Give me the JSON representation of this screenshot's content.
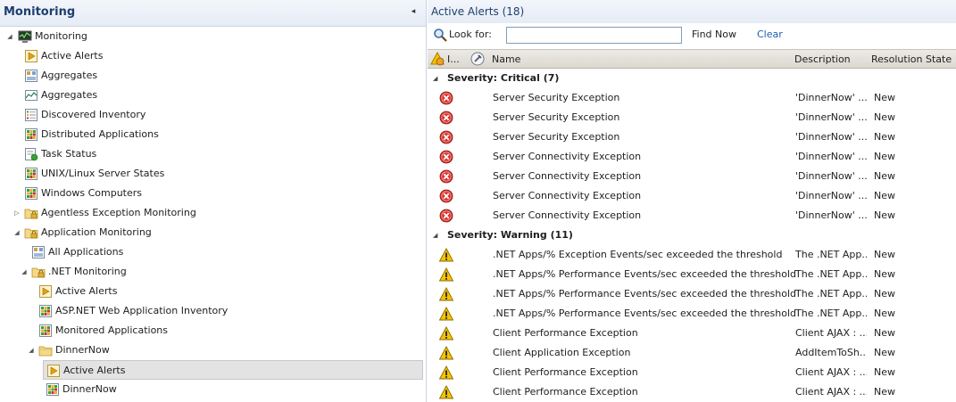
{
  "nav": {
    "title": "Monitoring",
    "collapse_glyph": "◂",
    "items": [
      {
        "label": "Monitoring",
        "icon": "monitor-icon",
        "expander": "◢"
      },
      {
        "label": "Active Alerts",
        "icon": "alert-view-icon",
        "expander": ""
      },
      {
        "label": "Aggregates",
        "icon": "dashboard-icon",
        "expander": ""
      },
      {
        "label": "Aggregates",
        "icon": "performance-icon",
        "expander": ""
      },
      {
        "label": "Discovered Inventory",
        "icon": "state-view-icon",
        "expander": ""
      },
      {
        "label": "Distributed Applications",
        "icon": "state-grid-icon",
        "expander": ""
      },
      {
        "label": "Task Status",
        "icon": "task-status-icon",
        "expander": ""
      },
      {
        "label": "UNIX/Linux Server States",
        "icon": "state-grid-icon",
        "expander": ""
      },
      {
        "label": "Windows Computers",
        "icon": "state-grid-icon",
        "expander": ""
      },
      {
        "label": "Agentless Exception Monitoring",
        "icon": "folder-lock-icon",
        "expander": "▷"
      },
      {
        "label": "Application Monitoring",
        "icon": "folder-lock-icon",
        "expander": "◢"
      },
      {
        "label": "All Applications",
        "icon": "dashboard-icon",
        "expander": ""
      },
      {
        "label": ".NET Monitoring",
        "icon": "folder-lock-icon",
        "expander": "◢"
      },
      {
        "label": "Active Alerts",
        "icon": "alert-view-icon",
        "expander": ""
      },
      {
        "label": "ASP.NET Web Application Inventory",
        "icon": "state-grid-icon",
        "expander": ""
      },
      {
        "label": "Monitored Applications",
        "icon": "state-grid-icon",
        "expander": ""
      },
      {
        "label": "DinnerNow",
        "icon": "folder-icon",
        "expander": "◢"
      },
      {
        "label": "Active Alerts",
        "icon": "alert-view-icon",
        "expander": ""
      },
      {
        "label": "DinnerNow",
        "icon": "state-grid-icon",
        "expander": ""
      }
    ]
  },
  "main": {
    "title": "Active Alerts",
    "count": "(18)",
    "search": {
      "label": "Look for:",
      "value": "",
      "find_label": "Find Now",
      "clear_label": "Clear"
    },
    "columns": {
      "icon_col": "I...",
      "name": "Name",
      "description": "Description",
      "resolution": "Resolution State"
    },
    "groups": [
      {
        "label": "Severity: Critical (7)",
        "expander": "◢",
        "severity": "critical",
        "alerts": [
          {
            "name": "Server Security Exception",
            "description": "'DinnerNow' ...",
            "state": "New"
          },
          {
            "name": "Server Security Exception",
            "description": "'DinnerNow' ...",
            "state": "New"
          },
          {
            "name": "Server Security Exception",
            "description": "'DinnerNow' ...",
            "state": "New"
          },
          {
            "name": "Server Connectivity Exception",
            "description": "'DinnerNow' ...",
            "state": "New"
          },
          {
            "name": "Server Connectivity Exception",
            "description": "'DinnerNow' ...",
            "state": "New"
          },
          {
            "name": "Server Connectivity Exception",
            "description": "'DinnerNow' ...",
            "state": "New"
          },
          {
            "name": "Server Connectivity Exception",
            "description": "'DinnerNow' ...",
            "state": "New"
          }
        ]
      },
      {
        "label": "Severity: Warning (11)",
        "expander": "◢",
        "severity": "warning",
        "alerts": [
          {
            "name": ".NET Apps/% Exception Events/sec exceeded the threshold",
            "description": "The .NET App...",
            "state": "New"
          },
          {
            "name": ".NET Apps/% Performance Events/sec exceeded the threshold",
            "description": "The .NET App...",
            "state": "New"
          },
          {
            "name": ".NET Apps/% Performance Events/sec exceeded the threshold",
            "description": "The .NET App...",
            "state": "New"
          },
          {
            "name": ".NET Apps/% Performance Events/sec exceeded the threshold",
            "description": "The .NET App...",
            "state": "New"
          },
          {
            "name": "Client Performance Exception",
            "description": "Client AJAX : ...",
            "state": "New"
          },
          {
            "name": "Client Application Exception",
            "description": "AddItemToSh...",
            "state": "New"
          },
          {
            "name": "Client Performance Exception",
            "description": "Client AJAX : ...",
            "state": "New"
          },
          {
            "name": "Client Performance Exception",
            "description": "Client AJAX : ...",
            "state": "New"
          }
        ]
      }
    ]
  },
  "colors": {
    "header_text": "#1e3f6e",
    "link": "#2060b0",
    "critical": "#d9312b",
    "warning": "#f5c400"
  }
}
